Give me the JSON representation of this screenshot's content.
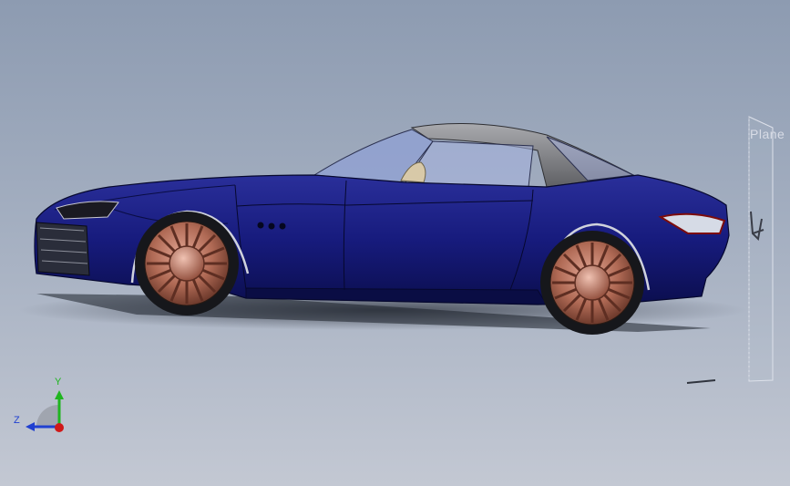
{
  "viewport": {
    "plane_label": "Plane",
    "triad": {
      "y_label": "Y",
      "z_label": "Z",
      "y_color": "#1fb51f",
      "z_color": "#2040d0",
      "x_color": "#d01818"
    }
  },
  "model": {
    "body_color": "#14187a",
    "wheel_color": "#b46e5a",
    "roof_color": "#7f8083",
    "glass_color": "#9aa8d6"
  }
}
